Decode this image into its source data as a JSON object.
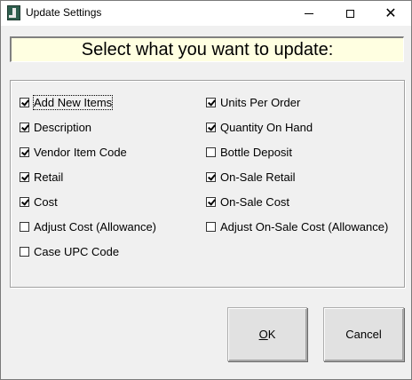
{
  "window": {
    "title": "Update Settings",
    "icon": "app-icon",
    "controls": {
      "minimize": "minimize-icon",
      "maximize": "maximize-icon",
      "close": "close-icon"
    }
  },
  "header": {
    "text": "Select what you want to update:"
  },
  "options_left": [
    {
      "label": "Add New Items",
      "checked": true
    },
    {
      "label": "Description",
      "checked": true
    },
    {
      "label": "Vendor Item Code",
      "checked": true
    },
    {
      "label": "Retail",
      "checked": true
    },
    {
      "label": "Cost",
      "checked": true
    },
    {
      "label": "Adjust Cost (Allowance)",
      "checked": false
    },
    {
      "label": "Case UPC Code",
      "checked": false
    }
  ],
  "options_right": [
    {
      "label": "Units Per Order",
      "checked": true
    },
    {
      "label": "Quantity On Hand",
      "checked": true
    },
    {
      "label": "Bottle Deposit",
      "checked": false
    },
    {
      "label": "On-Sale Retail",
      "checked": true
    },
    {
      "label": "On-Sale Cost",
      "checked": true
    },
    {
      "label": "Adjust On-Sale Cost (Allowance)",
      "checked": false
    }
  ],
  "buttons": {
    "ok": {
      "accel": "O",
      "rest": "K"
    },
    "cancel": "Cancel"
  }
}
